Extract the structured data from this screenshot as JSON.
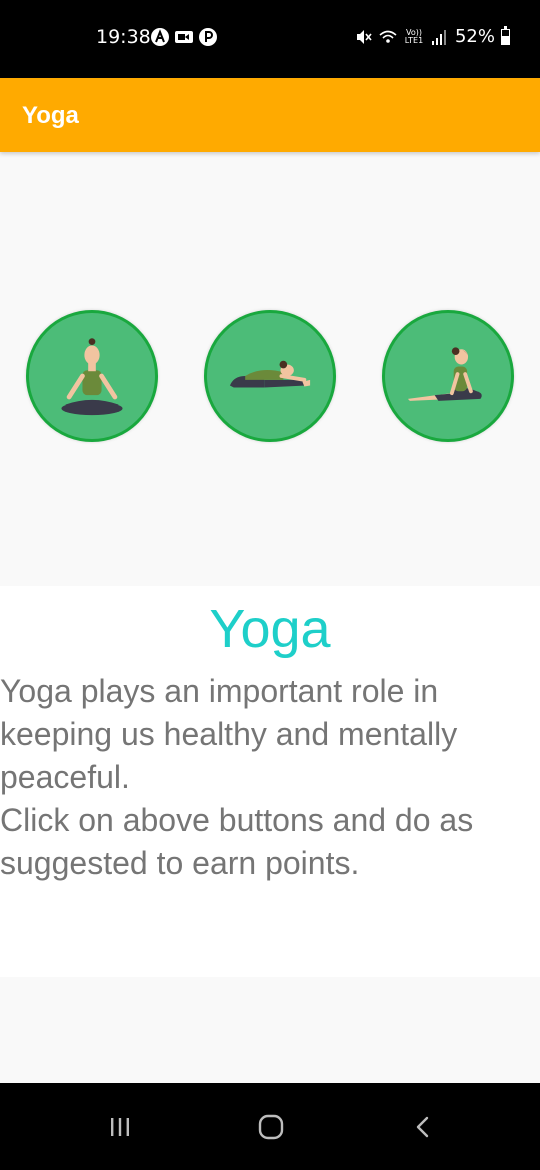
{
  "status_bar": {
    "time": "19:38",
    "left_icons": [
      "a-circle-icon",
      "video-icon",
      "p-circle-icon"
    ],
    "network_label": "Vo)) LTE1",
    "battery": "52%"
  },
  "app_bar": {
    "title": "Yoga",
    "color": "#ffaa00"
  },
  "poses": [
    {
      "name": "lotus-pose-icon"
    },
    {
      "name": "seated-forward-bend-icon"
    },
    {
      "name": "pigeon-pose-icon"
    }
  ],
  "info": {
    "title": "Yoga",
    "body": "Yoga plays an important role in keeping us healthy and mentally peaceful.\nClick on above buttons and do as suggested to earn points.",
    "title_color": "#1ecfc9"
  },
  "nav_bar": {
    "buttons": [
      "recent-apps-icon",
      "home-icon",
      "back-icon"
    ]
  }
}
